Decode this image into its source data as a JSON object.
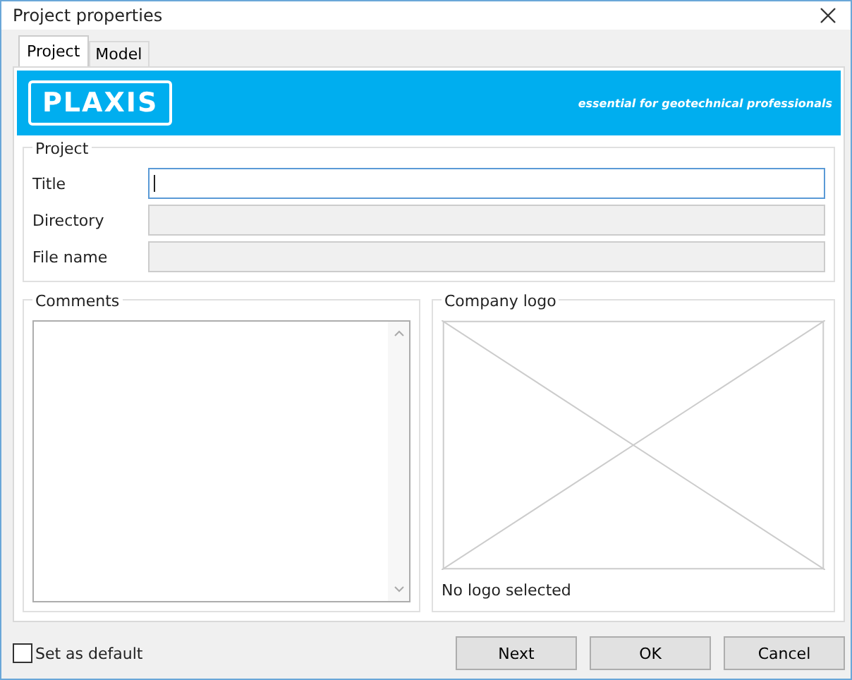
{
  "window": {
    "title": "Project properties"
  },
  "tabs": [
    {
      "label": "Project",
      "selected": true
    },
    {
      "label": "Model",
      "selected": false
    }
  ],
  "banner": {
    "logo": "PLAXIS",
    "tagline": "essential for geotechnical professionals"
  },
  "project_group": {
    "legend": "Project",
    "fields": [
      {
        "label": "Title",
        "focused": true,
        "disabled": false
      },
      {
        "label": "Directory",
        "focused": false,
        "disabled": true
      },
      {
        "label": "File name",
        "focused": false,
        "disabled": true
      }
    ]
  },
  "comments_group": {
    "legend": "Comments"
  },
  "logo_group": {
    "legend": "Company logo",
    "status": "No logo selected"
  },
  "default_checkbox": {
    "label": "Set as default",
    "checked": false
  },
  "buttons": [
    "Next",
    "OK",
    "Cancel"
  ]
}
